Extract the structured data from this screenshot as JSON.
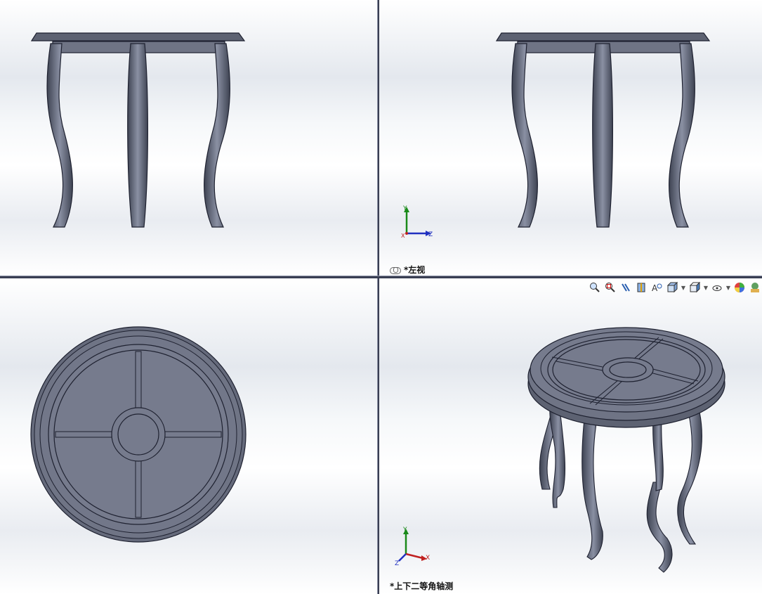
{
  "viewports": {
    "top_left": {
      "label": ""
    },
    "top_right": {
      "label": "*左视"
    },
    "bottom_left": {
      "label": ""
    },
    "bottom_right": {
      "label": "*上下二等角轴测"
    }
  },
  "triad": {
    "y": "Y",
    "z": "Z",
    "x": "X"
  },
  "heads_up_toolbar": [
    {
      "name": "zoom-to-fit-icon"
    },
    {
      "name": "zoom-to-area-icon"
    },
    {
      "name": "previous-view-icon"
    },
    {
      "name": "section-view-icon"
    },
    {
      "name": "dynamic-annotation-icon"
    },
    {
      "name": "view-orientation-icon",
      "dropdown": true
    },
    {
      "name": "display-style-icon",
      "dropdown": true
    },
    {
      "name": "hide-show-items-icon",
      "dropdown": true
    },
    {
      "name": "edit-appearance-icon"
    },
    {
      "name": "apply-scene-icon"
    }
  ],
  "colors": {
    "model_fill": "#6f7485",
    "model_dark": "#2f3342",
    "model_light": "#9aa0b2",
    "splitter": "#3a3f53"
  }
}
